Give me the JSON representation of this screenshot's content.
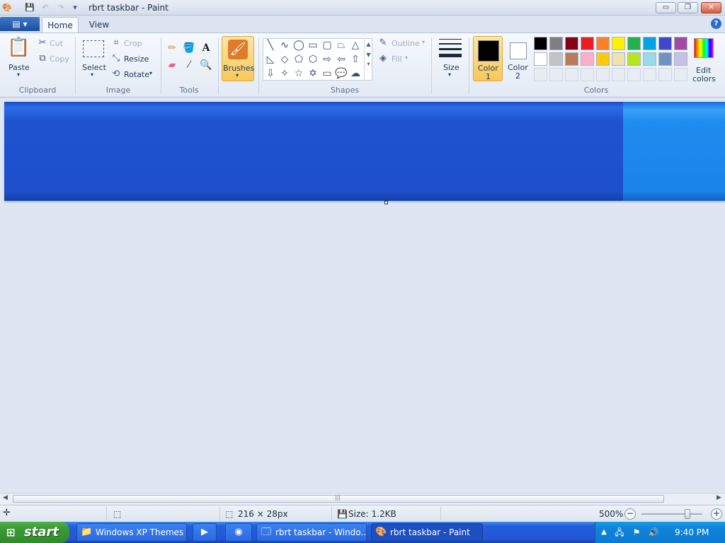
{
  "window": {
    "title": "rbrt taskbar - Paint"
  },
  "quick_access": {
    "save": "save-icon",
    "undo": "undo-icon",
    "redo": "redo-icon",
    "more": "▾"
  },
  "window_controls": {
    "minimize": "▭",
    "maximize": "❐",
    "close": "✕"
  },
  "tabs": [
    {
      "label": "Home"
    },
    {
      "label": "View"
    }
  ],
  "file_menu": {
    "label": "▤ ▾"
  },
  "ribbon": {
    "clipboard": {
      "label": "Clipboard",
      "paste": "Paste",
      "cut": "Cut",
      "copy": "Copy"
    },
    "image": {
      "label": "Image",
      "select": "Select",
      "crop": "Crop",
      "resize": "Resize",
      "rotate": "Rotate"
    },
    "tools": {
      "label": "Tools"
    },
    "brushes": {
      "label": "Brushes"
    },
    "shapes": {
      "label": "Shapes",
      "outline": "Outline",
      "fill": "Fill"
    },
    "size": {
      "label": "Size"
    },
    "colors": {
      "label": "Colors",
      "color1_line1": "Color",
      "color1_line2": "1",
      "color2_line1": "Color",
      "color2_line2": "2",
      "edit_line1": "Edit",
      "edit_line2": "colors"
    }
  },
  "palette": {
    "row1": [
      "#000000",
      "#7f7f7f",
      "#880015",
      "#ed1c24",
      "#ff7f27",
      "#fff200",
      "#22b14c",
      "#00a2e8",
      "#3f48cc",
      "#a349a4"
    ],
    "row2": [
      "#ffffff",
      "#c3c3c3",
      "#b97a57",
      "#ffaec9",
      "#ffc90e",
      "#efe4b0",
      "#b5e61d",
      "#99d9ea",
      "#7092be",
      "#c8bfe7"
    ],
    "row3": [
      "",
      "",
      "",
      "",
      "",
      "",
      "",
      "",
      "",
      ""
    ]
  },
  "colors": {
    "color1": "#000000",
    "color2": "#ffffff"
  },
  "status": {
    "dimensions": "216 × 28px",
    "size": "Size: 1.2KB",
    "zoom": "500%"
  },
  "taskbar": {
    "start": "start",
    "items": [
      {
        "label": "Windows XP Themes",
        "icon": "folder-icon"
      },
      {
        "label": "",
        "icon": "media-player-icon"
      },
      {
        "label": "",
        "icon": "chrome-icon"
      },
      {
        "label": "rbrt taskbar - Windo...",
        "icon": "window-icon"
      },
      {
        "label": "rbrt taskbar - Paint",
        "icon": "paint-icon"
      }
    ],
    "clock": "9:40 PM"
  }
}
